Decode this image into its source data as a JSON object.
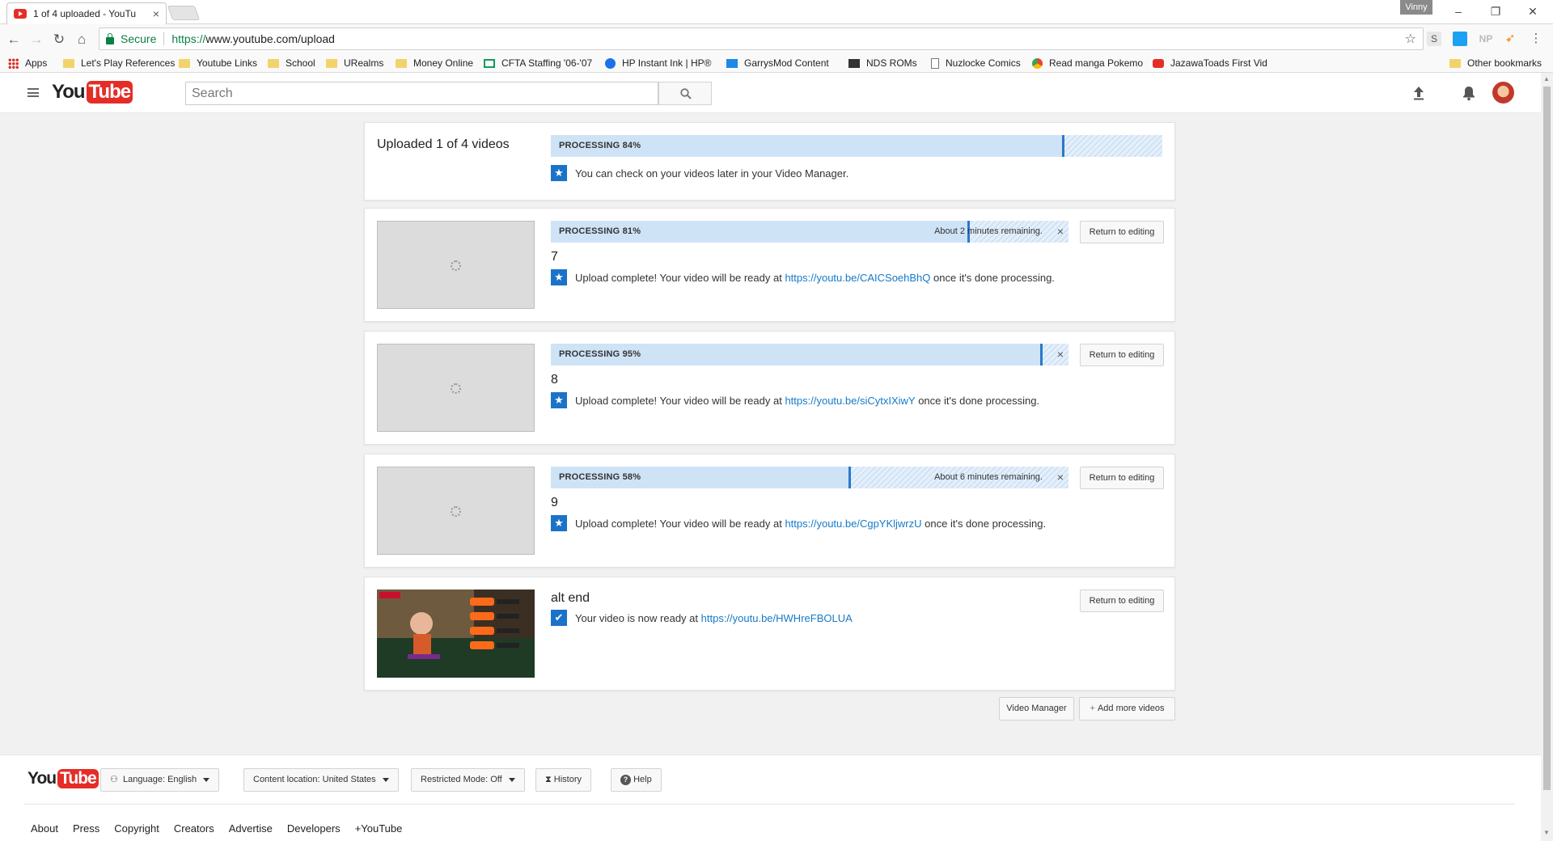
{
  "browser": {
    "tab_title": "1 of 4 uploaded - YouTu",
    "profile_name": "Vinny",
    "secure_label": "Secure",
    "url_scheme": "https://",
    "url_rest": "www.youtube.com/upload",
    "extensions": [
      "S",
      "",
      "NP",
      ""
    ],
    "bookmarks": [
      {
        "label": "Apps",
        "icon": "apps-icon"
      },
      {
        "label": "Let's Play References",
        "icon": "folder-icon"
      },
      {
        "label": "Youtube Links",
        "icon": "folder-icon"
      },
      {
        "label": "School",
        "icon": "folder-icon"
      },
      {
        "label": "URealms",
        "icon": "folder-icon"
      },
      {
        "label": "Money Online",
        "icon": "folder-icon"
      },
      {
        "label": "CFTA Staffing '06-'07",
        "icon": "sheets-icon"
      },
      {
        "label": "HP Instant Ink | HP®",
        "icon": "hp-icon"
      },
      {
        "label": "GarrysMod Content",
        "icon": "crossed-icon"
      },
      {
        "label": "NDS ROMs",
        "icon": "tv-icon"
      },
      {
        "label": "Nuzlocke Comics",
        "icon": "page-icon"
      },
      {
        "label": "Read manga Pokemo",
        "icon": "chrome-icon"
      },
      {
        "label": "JazawaToads First Vid",
        "icon": "youtube-icon"
      }
    ],
    "other_bookmarks": "Other bookmarks"
  },
  "masthead": {
    "logo_you": "You",
    "logo_tube": "Tube",
    "search_placeholder": "Search"
  },
  "summary": {
    "title": "Uploaded 1 of 4 videos",
    "progress_label": "PROCESSING 84%",
    "progress": 0.84,
    "note": "You can check on your videos later in your Video Manager."
  },
  "videos": [
    {
      "title": "7",
      "progress_label": "PROCESSING 81%",
      "progress": 0.81,
      "remaining": "About 2 minutes remaining.",
      "message_prefix": "Upload complete! Your video will be ready at",
      "link": "https://youtu.be/CAICSoehBhQ",
      "message_suffix": "once it's done processing.",
      "button": "Return to editing"
    },
    {
      "title": "8",
      "progress_label": "PROCESSING 95%",
      "progress": 0.95,
      "remaining": "",
      "message_prefix": "Upload complete! Your video will be ready at",
      "link": "https://youtu.be/siCytxIXiwY",
      "message_suffix": "once it's done processing.",
      "button": "Return to editing"
    },
    {
      "title": "9",
      "progress_label": "PROCESSING 58%",
      "progress": 0.58,
      "remaining": "About 6 minutes remaining.",
      "message_prefix": "Upload complete! Your video will be ready at",
      "link": "https://youtu.be/CgpYKljwrzU",
      "message_suffix": "once it's done processing.",
      "button": "Return to editing"
    }
  ],
  "ready_video": {
    "title": "alt end",
    "message_prefix": "Your video is now ready at",
    "link": "https://youtu.be/HWHreFBOLUA",
    "button": "Return to editing"
  },
  "actions": {
    "video_manager": "Video Manager",
    "add_more": "Add more videos"
  },
  "footer": {
    "language_prefix": "Language:",
    "language": "English",
    "location_prefix": "Content location:",
    "location": "United States",
    "restricted_prefix": "Restricted Mode:",
    "restricted": "Off",
    "history": "History",
    "help": "Help",
    "links": [
      "About",
      "Press",
      "Copyright",
      "Creators",
      "Advertise",
      "Developers",
      "+YouTube"
    ]
  },
  "colors": {
    "accent": "#2b78c9",
    "link": "#167ac6",
    "youtube_red": "#e52d27"
  }
}
